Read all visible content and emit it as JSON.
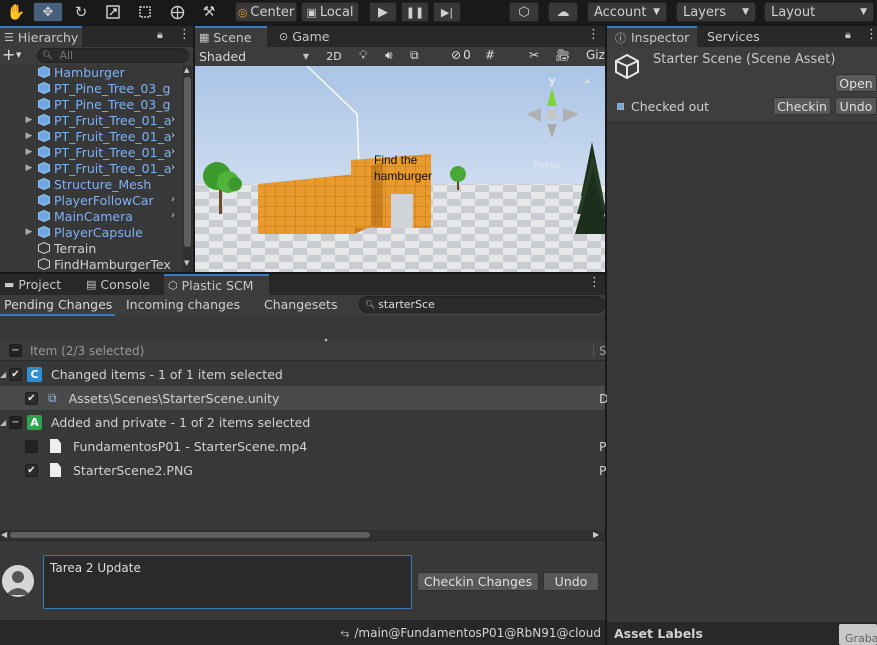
{
  "toolbar": {
    "center_label": "Center",
    "local_label": "Local",
    "account_label": "Account",
    "layers_label": "Layers",
    "layout_label": "Layout"
  },
  "hierarchy": {
    "tab_label": "Hierarchy",
    "search_placeholder": "All",
    "items": [
      {
        "label": "Hamburger",
        "color": "#7cb3f5",
        "expandable": false
      },
      {
        "label": "PT_Pine_Tree_03_g",
        "color": "#7cb3f5",
        "expandable": false
      },
      {
        "label": "PT_Pine_Tree_03_g",
        "color": "#7cb3f5",
        "expandable": false
      },
      {
        "label": "PT_Fruit_Tree_01_a",
        "color": "#7cb3f5",
        "expandable": true
      },
      {
        "label": "PT_Fruit_Tree_01_a",
        "color": "#7cb3f5",
        "expandable": true
      },
      {
        "label": "PT_Fruit_Tree_01_a",
        "color": "#7cb3f5",
        "expandable": true
      },
      {
        "label": "PT_Fruit_Tree_01_a",
        "color": "#7cb3f5",
        "expandable": true
      },
      {
        "label": "Structure_Mesh",
        "color": "#7cb3f5",
        "expandable": false
      },
      {
        "label": "PlayerFollowCar",
        "color": "#7cb3f5",
        "expandable": false
      },
      {
        "label": "MainCamera",
        "color": "#7cb3f5",
        "expandable": false
      },
      {
        "label": "PlayerCapsule",
        "color": "#7cb3f5",
        "expandable": true
      },
      {
        "label": "Terrain",
        "color": "#d2d2d2",
        "expandable": false
      },
      {
        "label": "FindHamburgerTex",
        "color": "#d2d2d2",
        "expandable": false
      }
    ]
  },
  "scene": {
    "tab_scene": "Scene",
    "tab_game": "Game",
    "shading_mode": "Shaded",
    "mode_2d": "2D",
    "hidden_count": "0",
    "gizmos_label": "Giz",
    "sign_text_line1": "Find the",
    "sign_text_line2": "hamburger",
    "axis_y": "y",
    "persp_label": "Persp"
  },
  "bottom_tabs": {
    "project": "Project",
    "console": "Console",
    "plastic": "Plastic SCM"
  },
  "scm": {
    "tab_pending": "Pending Changes",
    "tab_incoming": "Incoming changes",
    "tab_changesets": "Changesets",
    "search_value": "starterSce",
    "header_item": "Item (2/3 selected)",
    "header_status": "S",
    "group_changed": {
      "badge": "C",
      "badge_color": "#2e8fd6",
      "label": "Changed items - 1 of 1 item selected"
    },
    "group_added": {
      "badge": "A",
      "badge_color": "#2da44e",
      "label": "Added and private - 1 of 2 items selected"
    },
    "files": [
      {
        "name": "Assets\\Scenes\\StarterScene.unity",
        "checked": true,
        "status": "D"
      },
      {
        "name": "FundamentosP01 - StarterScene.mp4",
        "checked": false,
        "status": "P"
      },
      {
        "name": "StarterScene2.PNG",
        "checked": true,
        "status": "P"
      }
    ],
    "comment_value": "Tarea 2 Update",
    "checkin_changes_label": "Checkin Changes",
    "undo_label": "Undo",
    "branch_path": "/main@FundamentosP01@RbN91@cloud"
  },
  "inspector": {
    "tab_inspector": "Inspector",
    "tab_services": "Services",
    "asset_title": "Starter Scene (Scene Asset)",
    "open_label": "Open",
    "checked_out_label": "Checked out",
    "checkin_label": "Checkin",
    "undo_label": "Undo",
    "asset_labels": "Asset Labels",
    "graba_label": "Graba"
  }
}
